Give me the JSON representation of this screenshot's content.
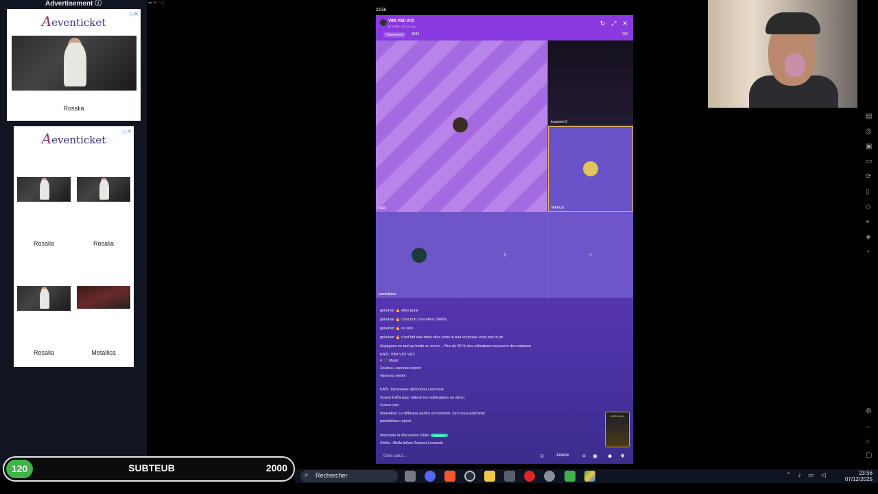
{
  "ads": {
    "header": "Advertisement ⓘ",
    "brand": "eventicket",
    "choices_icon": "ad-choices-icon",
    "ad1_label": "Rosalia",
    "ad2_labels": [
      "Rosalia",
      "Rosalia",
      "Rosalia",
      "Metallica"
    ]
  },
  "phone": {
    "status_time": "23:56",
    "room_title": "VINI VIDI VICI",
    "room_sub": "ID 12950 · 10 147 abo",
    "rank_label": "Classement",
    "points": "3633",
    "viewers": "130",
    "cells": {
      "main_name": "KAÏS",
      "dark_name": "loupinimi 3",
      "gold_name": "MARUU",
      "a_name": "pandeblaze"
    },
    "chat": [
      "gokuhan 🔥 elles parle",
      "gokuhan 🔥 c'est bon c'est elles 1000%",
      "gokuhan 🔥 ca voix",
      "gokuhan 🔥 c'est fait kais mais elles reste la bas et pénale vous pas le pb",
      "Rejoignez en tant qu'invité au micro – Plus de 80 % des utilisateurs reçoivent des cadeaux",
      "KAÏS: VINI VIDI VICI",
      "# 🎵 Music",
      "Zoubou Loumouk rejoint",
      "Vanessa rejoint",
      "KAÏS: bienvenue~@Zoubou Loumouk",
      "Suivez KAÏS pour obtenir les notifications en direct",
      "Suivez-moi",
      "Nouvelles: Le diffuseur partira un moment. Se il vous plaît tenir",
      "pandeblaze rejoint",
      "Rejoindre la discussion Vidéo",
      "Stella : Stella follow Zoubou Loumouk"
    ],
    "join_badge": "Rejoindre",
    "input_placeholder": "Dites salut...",
    "join_label": "Joindre",
    "gala_label": "2025 GALA"
  },
  "subbar": {
    "count": "120",
    "title": "SUBTEUB",
    "goal": "2000"
  },
  "taskbar": {
    "search_placeholder": "Rechercher",
    "time": "23:56",
    "date": "07/12/2025"
  }
}
